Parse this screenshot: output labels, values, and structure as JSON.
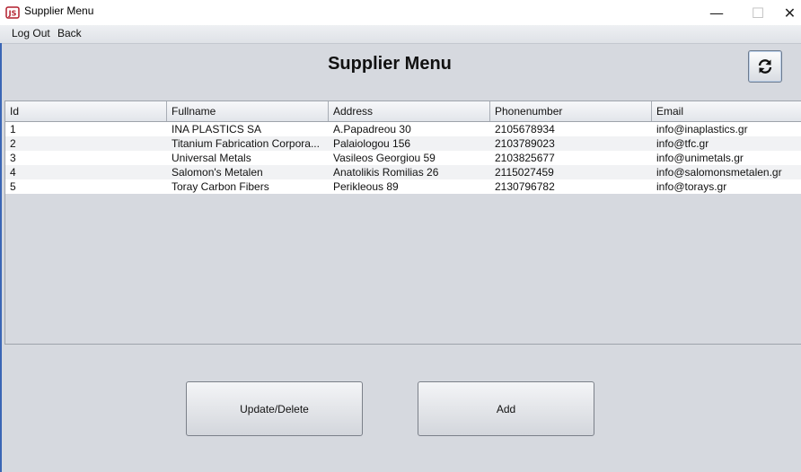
{
  "window": {
    "title": "Supplier Menu",
    "controls": {
      "minimize": "—",
      "maximize": "☐",
      "close": "✕"
    }
  },
  "menubar": {
    "items": [
      "Log Out",
      "Back"
    ]
  },
  "heading": "Supplier Menu",
  "refresh_icon": "refresh-icon",
  "table": {
    "columns": [
      "Id",
      "Fullname",
      "Address",
      "Phonenumber",
      "Email"
    ],
    "rows": [
      [
        "1",
        "INA PLASTICS SA",
        "A.Papadreou 30",
        "2105678934",
        "info@inaplastics.gr"
      ],
      [
        "2",
        "Titanium Fabrication Corpora...",
        "Palaiologou 156",
        "2103789023",
        "info@tfc.gr"
      ],
      [
        "3",
        "Universal Metals",
        "Vasileos Georgiou 59",
        "2103825677",
        "info@unimetals.gr"
      ],
      [
        "4",
        "Salomon's Metalen",
        "Anatolikis Romilias 26",
        "2115027459",
        "info@salomonsmetalen.gr"
      ],
      [
        "5",
        "Toray Carbon Fibers",
        "Perikleous 89",
        "2130796782",
        "info@torays.gr"
      ]
    ]
  },
  "buttons": {
    "update_delete": "Update/Delete",
    "add": "Add"
  },
  "colors": {
    "background": "#d6d9df",
    "accent_border": "#3a66b5"
  }
}
